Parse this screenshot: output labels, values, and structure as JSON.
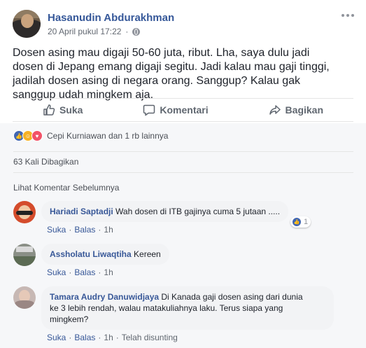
{
  "post": {
    "author": "Hasanudin Abdurakhman",
    "date": "20 April pukul 17:22",
    "date_separator": "·",
    "text": "Dosen asing mau digaji 50-60 juta, ribut. Lha, saya dulu jadi dosen di Jepang emang digaji segitu. Jadi kalau mau gaji tinggi, jadilah dosen asing di negara orang. Sanggup? Kalau gak sanggup udah mingkem aja.",
    "actions": {
      "like": "Suka",
      "comment": "Komentari",
      "share": "Bagikan"
    }
  },
  "reactions": {
    "summary": "Cepi Kurniawan dan 1 rb lainnya",
    "icons": [
      "like-icon",
      "haha-icon",
      "love-icon"
    ]
  },
  "shares": "63 Kali Dibagikan",
  "view_previous": "Lihat Komentar Sebelumnya",
  "comments": [
    {
      "author": "Hariadi Saptadji",
      "text": "Wah dosen di ITB gajinya cuma 5 jutaan .....",
      "like": "Suka",
      "reply": "Balas",
      "time": "1h",
      "like_count": "1"
    },
    {
      "author": "Assholatu Liwaqtiha",
      "text": "Kereen",
      "like": "Suka",
      "reply": "Balas",
      "time": "1h"
    },
    {
      "author": "Tamara Audry Danuwidjaya",
      "text_line1": "Di Kanada gaji dosen asing dari dunia",
      "text_line2": "ke 3 lebih rendah, walau matakuliahnya laku. Terus siapa yang",
      "text_line3": "mingkem?",
      "like": "Suka",
      "reply": "Balas",
      "time": "1h",
      "edited": "Telah disunting"
    }
  ],
  "colors": {
    "link": "#365899",
    "like_blue": "#4267b2",
    "haha_yellow": "#f7b125",
    "love_red": "#f25268"
  }
}
